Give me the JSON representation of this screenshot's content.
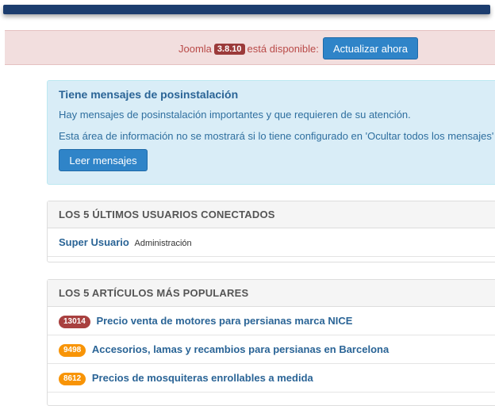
{
  "update": {
    "prefix": "Joomla",
    "version": "3.8.10",
    "suffix": "está disponible:",
    "button_label": "Actualizar ahora"
  },
  "postinstall": {
    "title": "Tiene mensajes de posinstalación",
    "line1": "Hay mensajes de posinstalación importantes y que requieren de su atención.",
    "line2": "Esta área de información no se mostrará si lo tiene configurado en 'Ocultar todos los mensajes'",
    "button_label": "Leer mensajes"
  },
  "logged_users": {
    "header": "LOS 5 ÚLTIMOS USUARIOS CONECTADOS",
    "users": [
      {
        "name": "Super Usuario",
        "role": "Administración"
      }
    ]
  },
  "popular": {
    "header": "LOS 5 ARTÍCULOS MÁS POPULARES",
    "articles": [
      {
        "hits": "13014",
        "color": "#a8403f",
        "title": "Precio venta de motores para persianas marca NICE"
      },
      {
        "hits": "9498",
        "color": "#f89406",
        "title": "Accesorios, lamas y recambios para persianas en Barcelona"
      },
      {
        "hits": "8612",
        "color": "#f89406",
        "title": "Precios de mosquiteras enrollables a medida"
      }
    ]
  },
  "colors": {
    "accent_blue": "#2f84c8",
    "alert_red_bg": "#f2dede",
    "info_bg": "#d9edf7",
    "topbar": "#1c3d6e"
  }
}
